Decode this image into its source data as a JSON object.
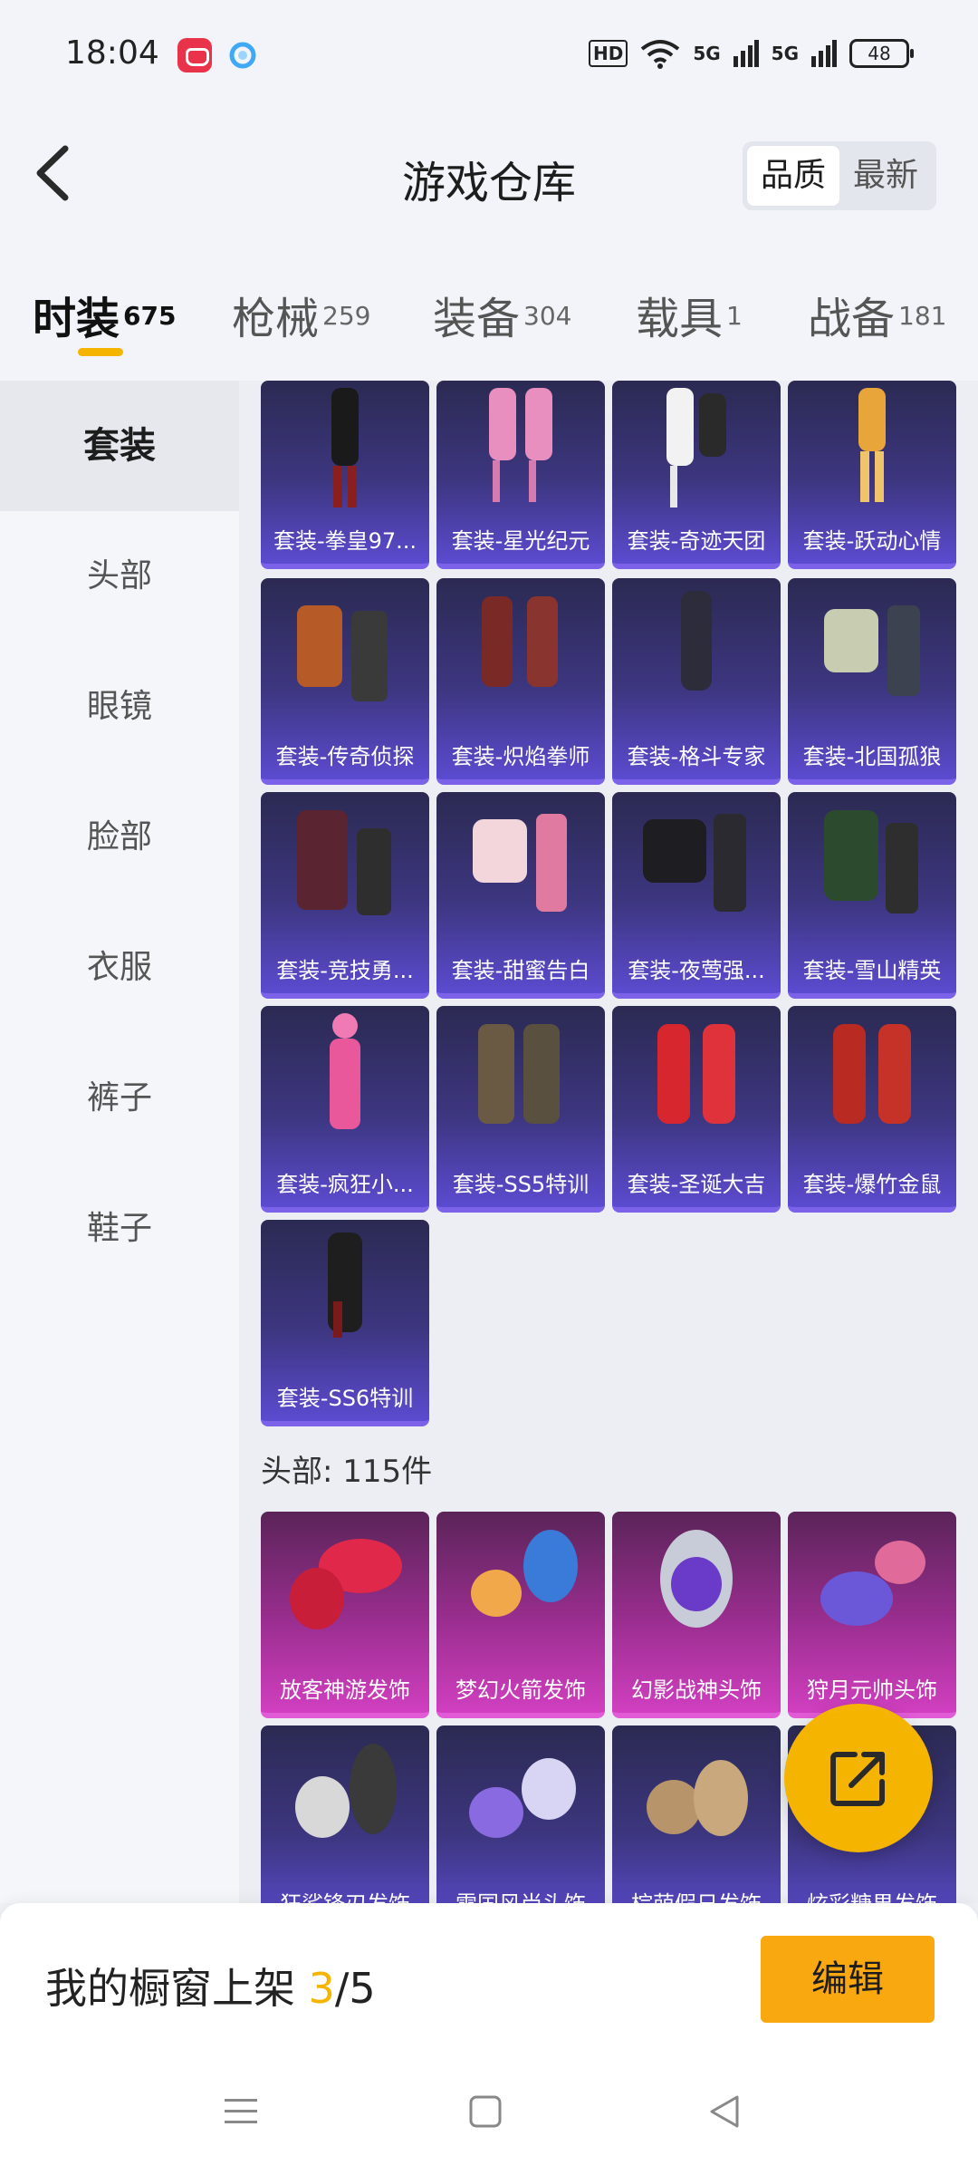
{
  "status_bar": {
    "time": "18:04",
    "hd": "HD",
    "sig1": "5G",
    "sig2": "5G",
    "battery": "48"
  },
  "header": {
    "title": "游戏仓库",
    "sort_options": [
      "品质",
      "最新"
    ],
    "sort_active": "品质"
  },
  "tabs": [
    {
      "label": "时装",
      "count": "675",
      "active": true
    },
    {
      "label": "枪械",
      "count": "259"
    },
    {
      "label": "装备",
      "count": "304"
    },
    {
      "label": "载具",
      "count": "1"
    },
    {
      "label": "战备",
      "count": "181"
    }
  ],
  "sidebar": {
    "items": [
      {
        "label": "套装",
        "active": true
      },
      {
        "label": "头部"
      },
      {
        "label": "眼镜"
      },
      {
        "label": "脸部"
      },
      {
        "label": "衣服"
      },
      {
        "label": "裤子"
      },
      {
        "label": "鞋子"
      }
    ]
  },
  "suits": [
    "套装-拳皇97...",
    "套装-星光纪元",
    "套装-奇迹天团",
    "套装-跃动心情",
    "套装-传奇侦探",
    "套装-炽焰拳师",
    "套装-格斗专家",
    "套装-北国孤狼",
    "套装-竞技勇...",
    "套装-甜蜜告白",
    "套装-夜莺强...",
    "套装-雪山精英",
    "套装-疯狂小...",
    "套装-SS5特训",
    "套装-圣诞大吉",
    "套装-爆竹金鼠",
    "套装-SS6特训"
  ],
  "head_section": {
    "title": "头部: 115件"
  },
  "head_items": [
    {
      "name": "放客神游发饰",
      "rarity": "pink"
    },
    {
      "name": "梦幻火箭发饰",
      "rarity": "pink"
    },
    {
      "name": "幻影战神头饰",
      "rarity": "pink"
    },
    {
      "name": "狩月元帅头饰",
      "rarity": "pink"
    },
    {
      "name": "狂鲨锋刃发饰",
      "rarity": "purple"
    },
    {
      "name": "雪国风尚头饰",
      "rarity": "purple"
    },
    {
      "name": "棕萌假日发饰",
      "rarity": "purple"
    },
    {
      "name": "炫彩糖果发饰",
      "rarity": "purple"
    }
  ],
  "bottom": {
    "shelf_label": "我的橱窗上架 ",
    "shelf_current": "3",
    "shelf_total": "/5",
    "edit_label": "编辑"
  },
  "colors": {
    "accent": "#f5b400",
    "purple_card": "#4a3fa8",
    "pink_card": "#b83aa8"
  },
  "icons": {
    "back": "chevron-left-icon",
    "share": "share-icon",
    "menu": "menu-icon",
    "home": "home-icon",
    "nav_back": "triangle-back-icon"
  }
}
